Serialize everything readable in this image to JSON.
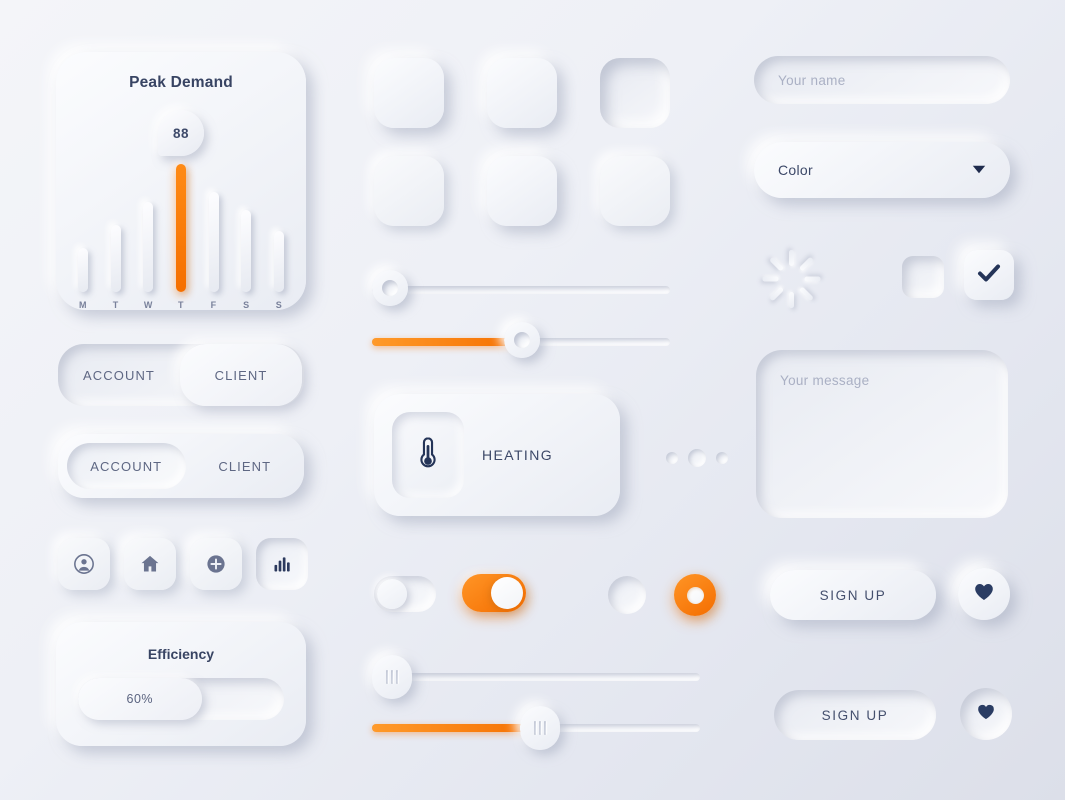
{
  "theme": {
    "accent_orange": "#f97306",
    "surface_light": "#f4f5f9",
    "surface_dark": "#dcdfe9",
    "text_dark": "#2e3a57",
    "text_muted": "#aab0c4"
  },
  "peak_demand": {
    "title": "Peak Demand",
    "badge_value": "88",
    "icon": "bar-chart-widget"
  },
  "chart_data": {
    "type": "bar",
    "title": "Peak Demand",
    "categories": [
      "M",
      "T",
      "W",
      "T",
      "F",
      "S",
      "S"
    ],
    "values": [
      34,
      52,
      70,
      100,
      78,
      64,
      48
    ],
    "highlight_index": 3,
    "highlight_value": "88",
    "xlabel": "",
    "ylabel": "",
    "ylim": [
      0,
      100
    ],
    "grid": false,
    "legend": false
  },
  "segmented_tabs": [
    {
      "id": "segmented-1",
      "style": "raised-active",
      "items": [
        {
          "label": "ACCOUNT",
          "active": false
        },
        {
          "label": "CLIENT",
          "active": true
        }
      ]
    },
    {
      "id": "segmented-2",
      "style": "inset-active",
      "items": [
        {
          "label": "ACCOUNT",
          "active": true
        },
        {
          "label": "CLIENT",
          "active": false
        }
      ]
    }
  ],
  "icon_buttons": [
    {
      "icon": "user-icon",
      "name": "account",
      "state": "raised"
    },
    {
      "icon": "home-icon",
      "name": "home",
      "state": "raised"
    },
    {
      "icon": "plus-circle-icon",
      "name": "add",
      "state": "raised"
    },
    {
      "icon": "bar-chart-icon",
      "name": "stats",
      "state": "pressed"
    }
  ],
  "efficiency": {
    "title": "Efficiency",
    "value_label": "60%",
    "percent": 60
  },
  "square_buttons": [
    {
      "id": "sq-1",
      "style": "raised"
    },
    {
      "id": "sq-2",
      "style": "raised"
    },
    {
      "id": "sq-3",
      "style": "inset"
    },
    {
      "id": "sq-4",
      "style": "raised-soft"
    },
    {
      "id": "sq-5",
      "style": "raised"
    },
    {
      "id": "sq-6",
      "style": "raised-soft"
    }
  ],
  "round_sliders": [
    {
      "id": "slider-1",
      "percent": 0,
      "filled": false
    },
    {
      "id": "slider-2",
      "percent": 49,
      "filled": true
    }
  ],
  "heating": {
    "label": "HEATING",
    "icon": "thermometer-icon"
  },
  "pagination": {
    "dots": [
      {
        "size": "sm",
        "active": false
      },
      {
        "size": "lg",
        "active": true
      },
      {
        "size": "sm",
        "active": false
      }
    ]
  },
  "toggles": [
    {
      "id": "toggle-off",
      "state": "off",
      "label": ""
    },
    {
      "id": "toggle-on",
      "state": "on",
      "label": ""
    }
  ],
  "radios": [
    {
      "id": "radio-off",
      "state": "off"
    },
    {
      "id": "radio-on",
      "state": "on"
    }
  ],
  "grip_sliders": [
    {
      "id": "grip-slider-1",
      "percent": 0,
      "filled": false
    },
    {
      "id": "grip-slider-2",
      "percent": 46,
      "filled": true
    }
  ],
  "form": {
    "name_input": {
      "placeholder": "Your name",
      "value": ""
    },
    "color_select": {
      "value": "Color",
      "caret": "chevron-down-icon"
    },
    "message_textarea": {
      "placeholder": "Your message",
      "value": ""
    }
  },
  "loader": {
    "icon": "spinner-icon",
    "spokes": 8
  },
  "checkboxes": [
    {
      "id": "checkbox-empty",
      "checked": false,
      "icon": ""
    },
    {
      "id": "checkbox-checked",
      "checked": true,
      "icon": "check-icon"
    }
  ],
  "cta_buttons": [
    {
      "id": "signup-raised",
      "label": "SIGN UP",
      "style": "raised"
    },
    {
      "id": "signup-inset",
      "label": "SIGN UP",
      "style": "inset"
    }
  ],
  "heart_buttons": [
    {
      "id": "heart-raised",
      "icon": "heart-icon",
      "style": "raised"
    },
    {
      "id": "heart-inset",
      "icon": "heart-icon",
      "style": "inset"
    }
  ]
}
